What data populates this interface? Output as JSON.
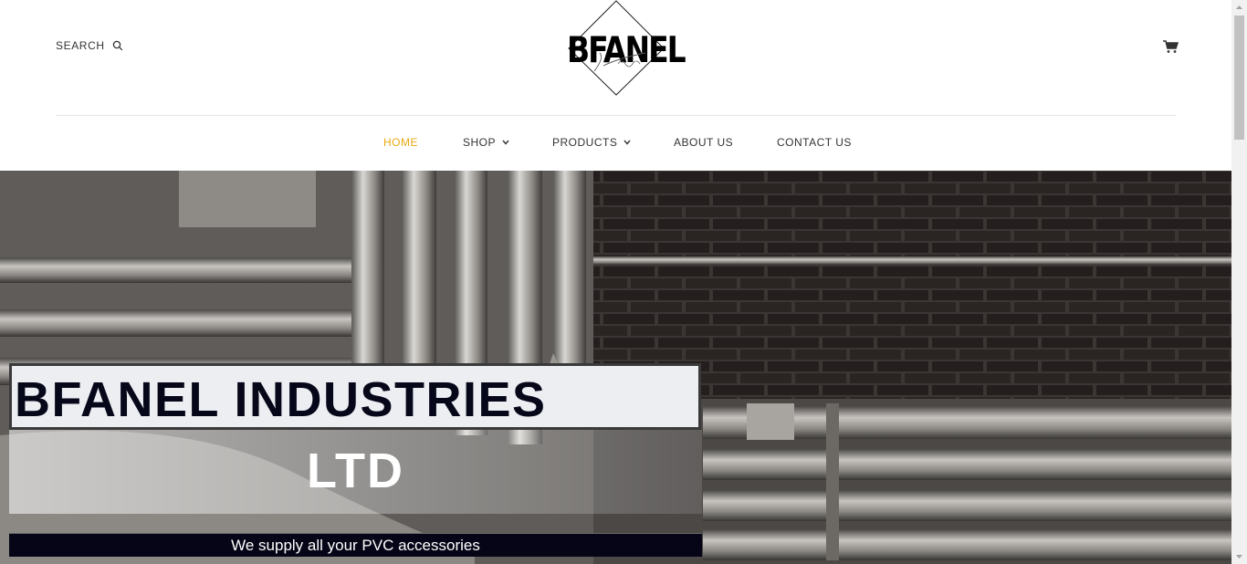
{
  "header": {
    "search_label": "SEARCH",
    "logo_text": "BFANEL",
    "logo_script": "LTD"
  },
  "nav": {
    "items": [
      {
        "label": "HOME",
        "active": true,
        "dropdown": false
      },
      {
        "label": "SHOP",
        "active": false,
        "dropdown": true
      },
      {
        "label": "PRODUCTS",
        "active": false,
        "dropdown": true
      },
      {
        "label": "ABOUT US",
        "active": false,
        "dropdown": false
      },
      {
        "label": "CONTACT US",
        "active": false,
        "dropdown": false
      }
    ]
  },
  "hero": {
    "title": "BFANEL INDUSTRIES",
    "subtitle": "LTD",
    "tagline": "We supply all your PVC accessories"
  },
  "colors": {
    "accent": "#e8a912",
    "text": "#333333",
    "title_navy": "#07071a"
  },
  "icons": {
    "search": "search-icon",
    "cart": "cart-icon",
    "chevron": "chevron-down-icon"
  }
}
